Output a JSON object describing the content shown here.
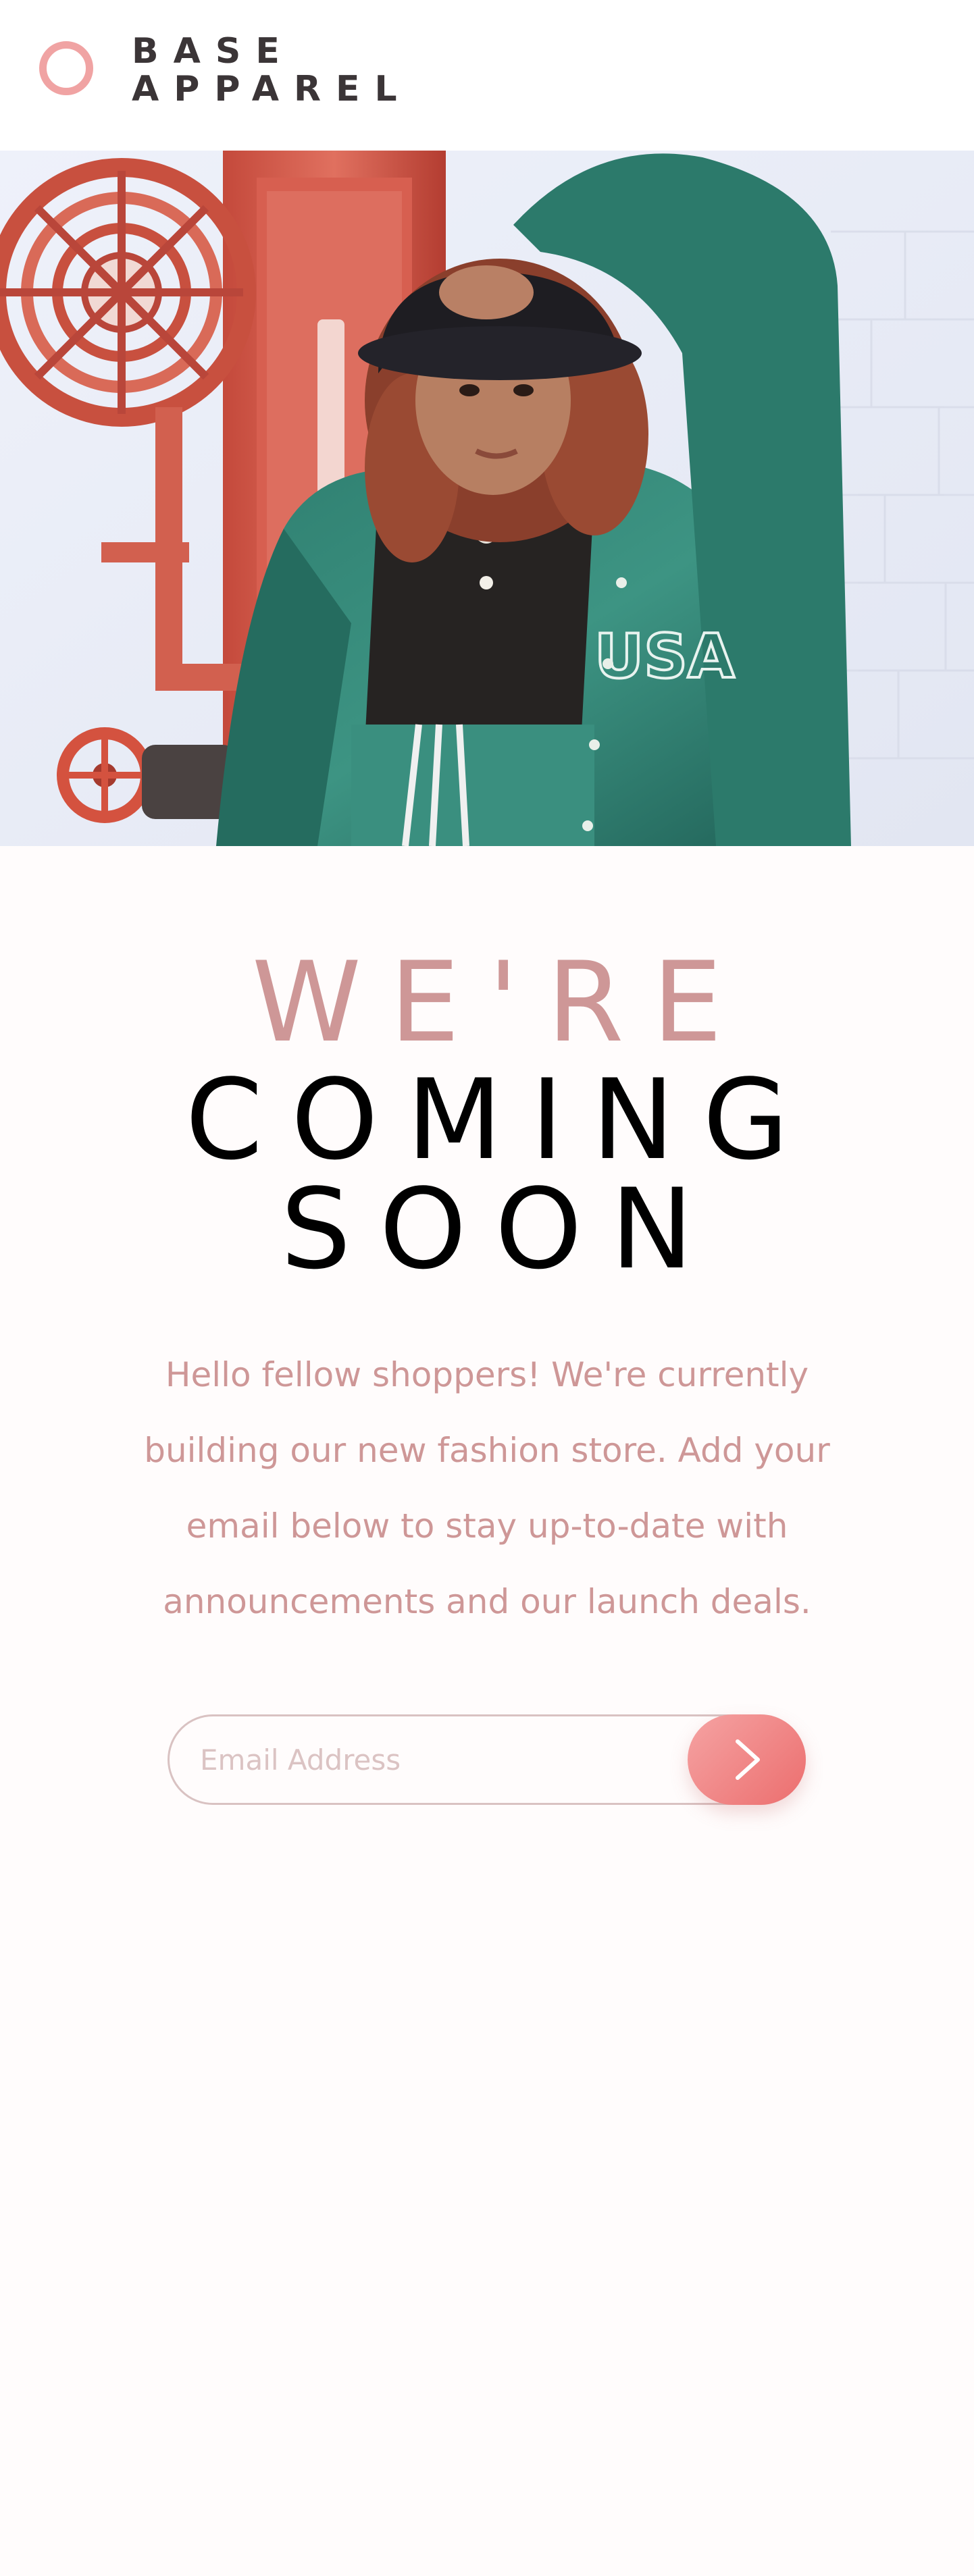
{
  "brand": {
    "name_line1": "BASE",
    "name_line2": "APPAREL",
    "ring_color": "#f0a3a3",
    "text_color": "#3b3537"
  },
  "hero": {
    "alt": "Model in green satin jacket and black bucket hat posing by a red fire hose reel"
  },
  "heading": {
    "line1": "WE'RE",
    "line2": "COMING",
    "line3": "SOON"
  },
  "description": "Hello fellow shoppers! We're currently building our new fashion store. Add your email below to stay up-to-date with announcements and our launch deals.",
  "form": {
    "email_placeholder": "Email Address",
    "email_value": "",
    "submit_icon": "arrow-right-icon"
  },
  "colors": {
    "accent_text": "#ce9797",
    "heading_dark": "#000000",
    "button_gradient_start": "#f5a3a3",
    "button_gradient_end": "#ec6e6e",
    "background": "#fffcfc"
  }
}
